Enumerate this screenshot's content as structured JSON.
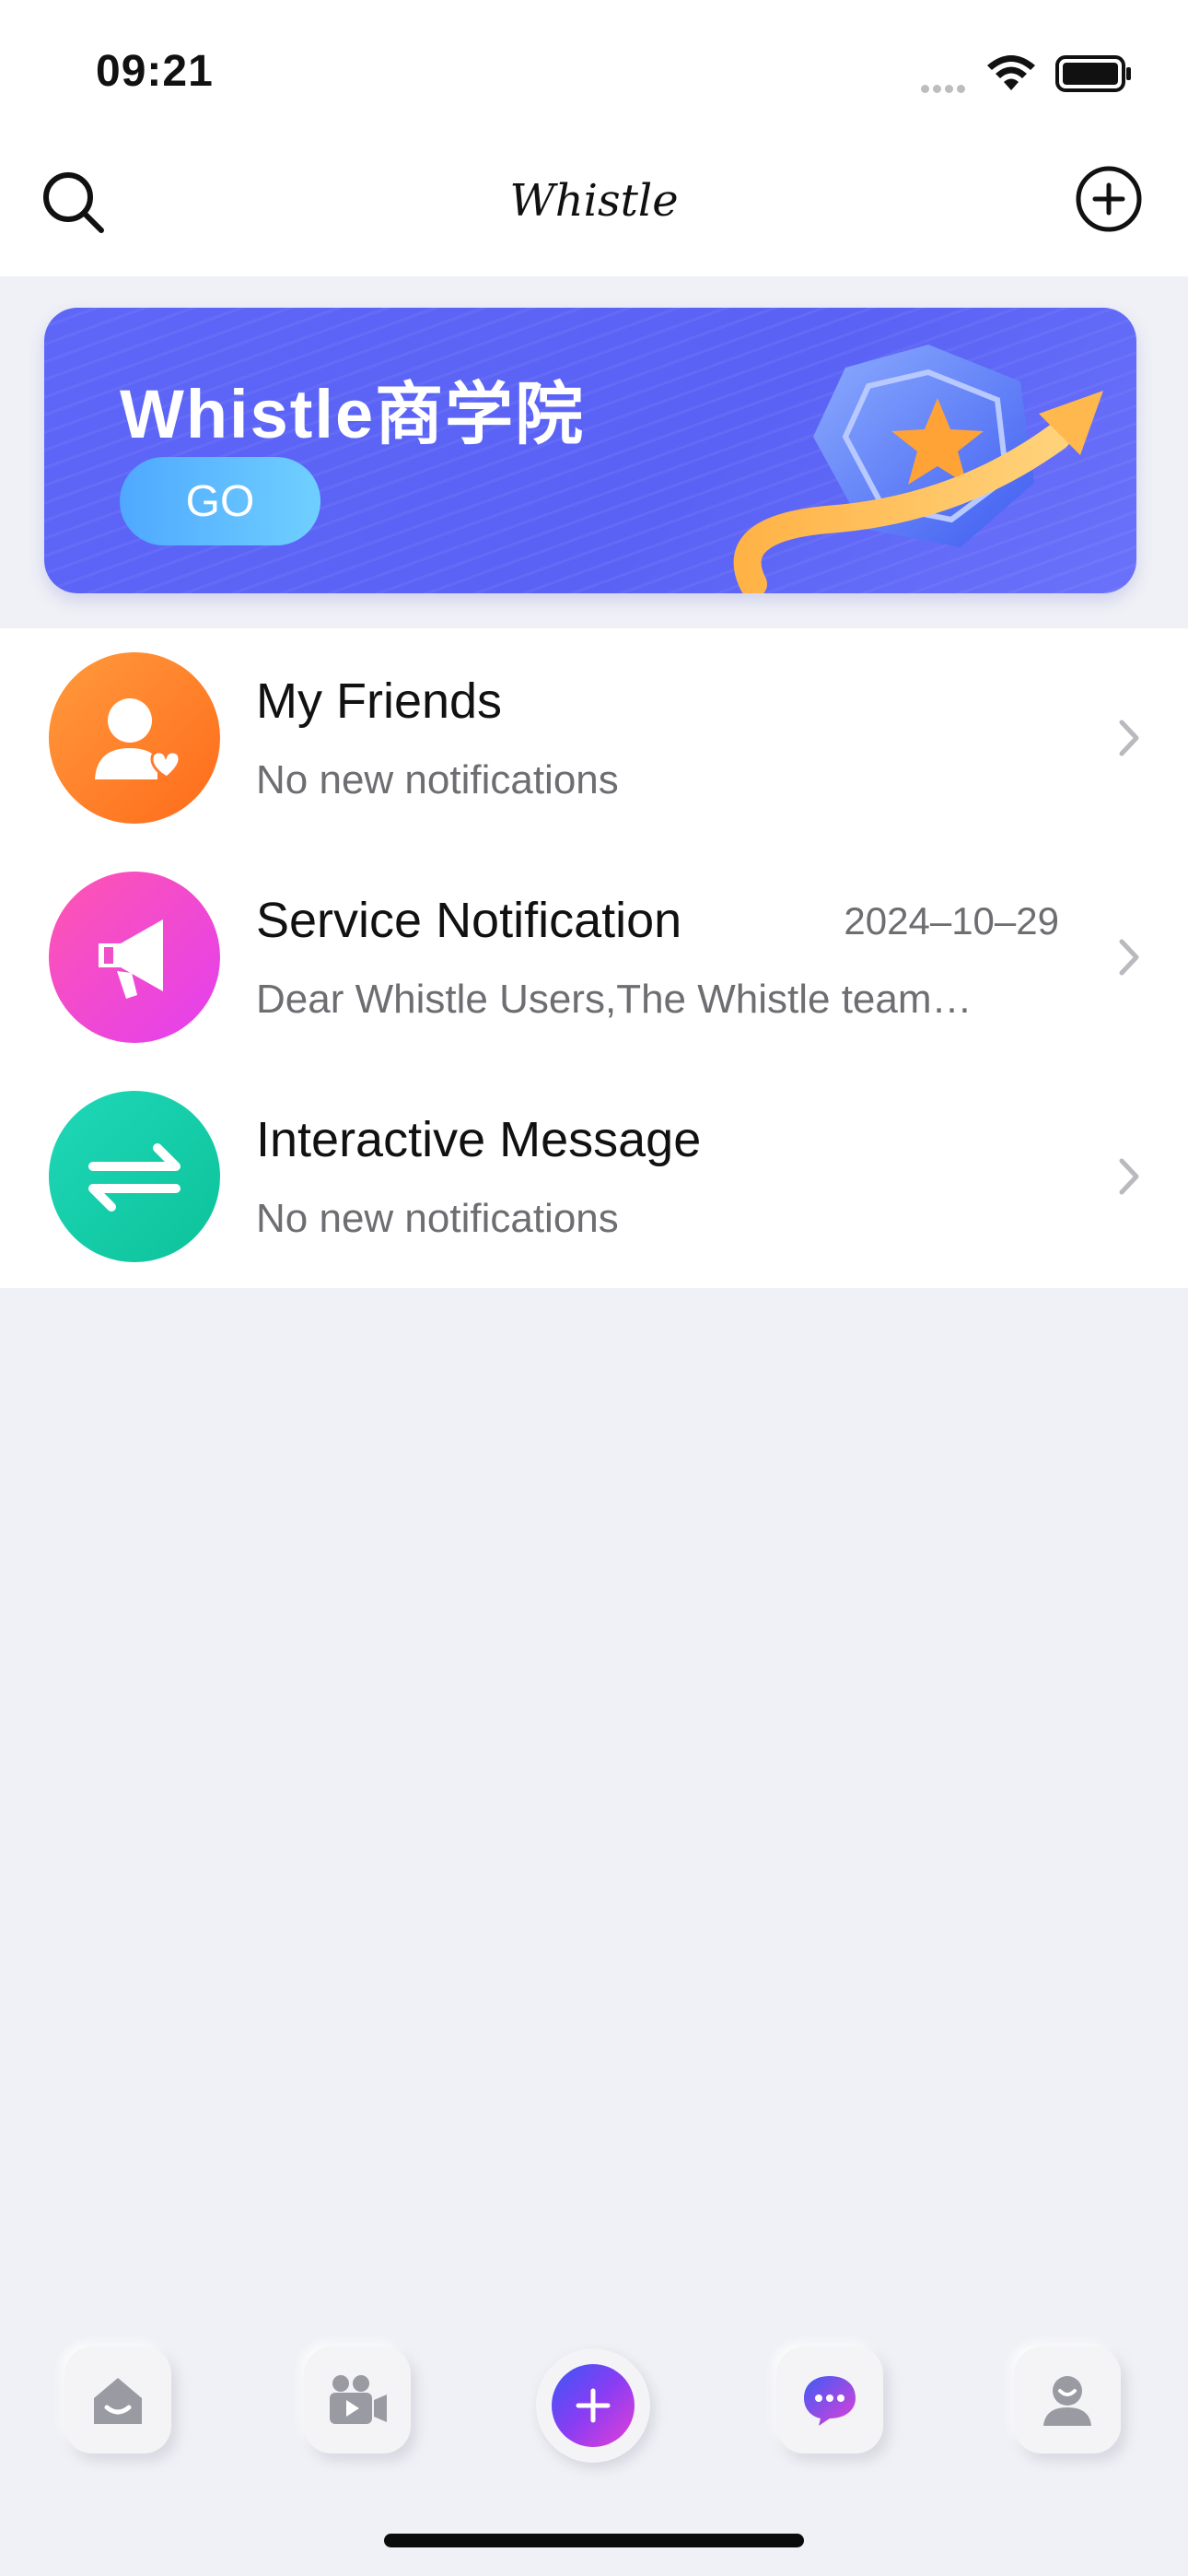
{
  "status_bar": {
    "time": "09:21"
  },
  "header": {
    "title": "Whistle"
  },
  "banner": {
    "title": "Whistle商学院",
    "button_label": "GO"
  },
  "messages": [
    {
      "title": "My Friends",
      "subtitle": "No new notifications",
      "date": "",
      "icon": "friend-heart-icon",
      "color": "#ff7a2f"
    },
    {
      "title": "Service Notification",
      "subtitle": "Dear Whistle Users,The Whistle team…",
      "date": "2024–10–29",
      "icon": "megaphone-icon",
      "color": "#f03fd0"
    },
    {
      "title": "Interactive Message",
      "subtitle": "No new notifications",
      "date": "",
      "icon": "swap-arrows-icon",
      "color": "#16d1b0"
    }
  ],
  "tabs": [
    {
      "name": "home",
      "icon": "home-icon"
    },
    {
      "name": "video",
      "icon": "video-camera-icon"
    },
    {
      "name": "add",
      "icon": "plus-icon"
    },
    {
      "name": "messages",
      "icon": "chat-bubble-icon",
      "active": true
    },
    {
      "name": "profile",
      "icon": "user-icon"
    }
  ]
}
